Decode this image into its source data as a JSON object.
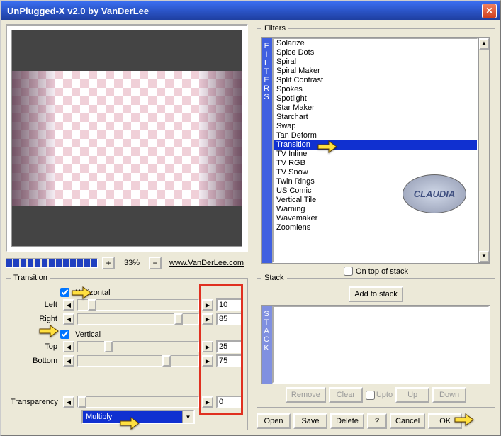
{
  "window": {
    "title": "UnPlugged-X v2.0 by VanDerLee"
  },
  "zoom": {
    "percent": "33%",
    "url": "www.VanDerLee.com"
  },
  "transition": {
    "legend": "Transition",
    "horizontal_label": "Horizontal",
    "vertical_label": "Vertical",
    "left": {
      "label": "Left",
      "value": "10"
    },
    "right": {
      "label": "Right",
      "value": "85"
    },
    "top": {
      "label": "Top",
      "value": "25"
    },
    "bottom": {
      "label": "Bottom",
      "value": "75"
    },
    "transparency": {
      "label": "Transparency",
      "value": "0"
    },
    "blend_mode": "Multiply"
  },
  "filters": {
    "legend": "Filters",
    "tab": "FILTERS",
    "items": [
      "Solarize",
      "Spice Dots",
      "Spiral",
      "Spiral Maker",
      "Split Contrast",
      "Spokes",
      "Spotlight",
      "Star Maker",
      "Starchart",
      "Swap",
      "Tan Deform",
      "Transition",
      "TV Inline",
      "TV RGB",
      "TV Snow",
      "Twin Rings",
      "US Comic",
      "Vertical Tile",
      "Warning",
      "Wavemaker",
      "Zoomlens"
    ],
    "selected": "Transition",
    "on_top_label": "On top of stack"
  },
  "stack": {
    "legend": "Stack",
    "tab": "STACK",
    "add_label": "Add to stack",
    "remove": "Remove",
    "clear": "Clear",
    "upto": "Upto",
    "up": "Up",
    "down": "Down"
  },
  "buttons": {
    "open": "Open",
    "save": "Save",
    "delete": "Delete",
    "help": "?",
    "cancel": "Cancel",
    "ok": "OK"
  },
  "badge": "CLAUDIA"
}
